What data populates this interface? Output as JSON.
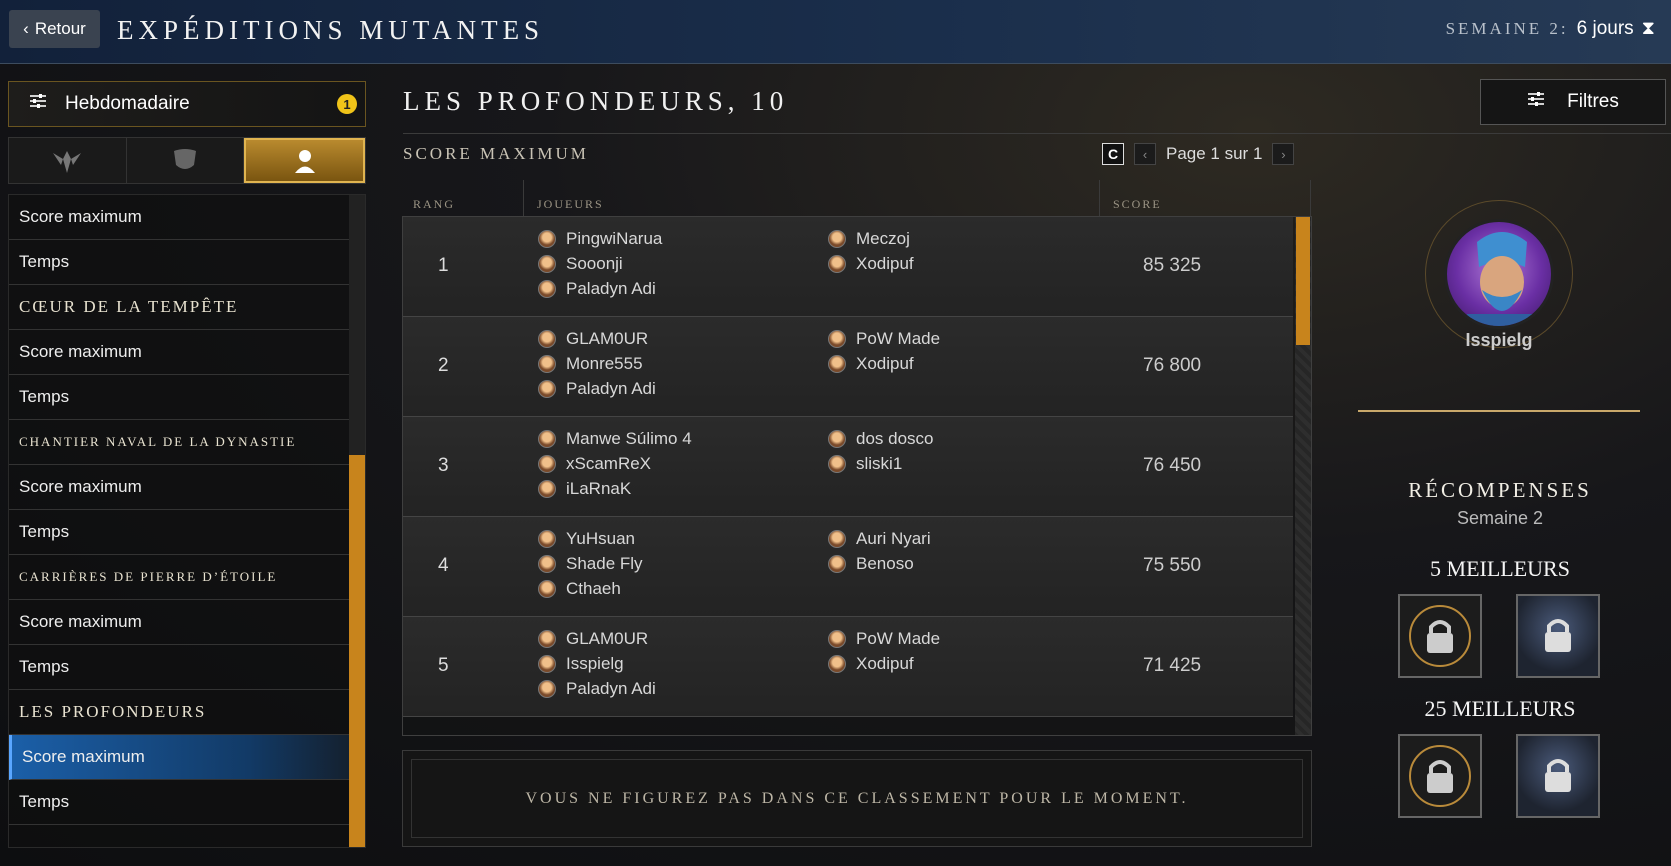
{
  "header": {
    "back_label": "Retour",
    "title": "EXPÉDITIONS MUTANTES",
    "week_label": "SEMAINE 2:",
    "time_left": "6 jours"
  },
  "sidebar": {
    "period_label": "Hebdomadaire",
    "period_badge": "1",
    "tabs": [
      "wings-emblem-icon",
      "shield-icon",
      "player-icon"
    ],
    "items": [
      {
        "type": "item",
        "label": "Score maximum"
      },
      {
        "type": "item",
        "label": "Temps"
      },
      {
        "type": "header",
        "label": "CŒUR DE LA TEMPÊTE"
      },
      {
        "type": "item",
        "label": "Score maximum"
      },
      {
        "type": "item",
        "label": "Temps"
      },
      {
        "type": "header",
        "label": "CHANTIER NAVAL DE LA DYNASTIE"
      },
      {
        "type": "item",
        "label": "Score maximum"
      },
      {
        "type": "item",
        "label": "Temps"
      },
      {
        "type": "header",
        "label": "CARRIÈRES DE PIERRE D’ÉTOILE"
      },
      {
        "type": "item",
        "label": "Score maximum"
      },
      {
        "type": "item",
        "label": "Temps"
      },
      {
        "type": "header",
        "label": "LES PROFONDEURS"
      },
      {
        "type": "item",
        "label": "Score maximum",
        "selected": true
      },
      {
        "type": "item",
        "label": "Temps"
      }
    ]
  },
  "main": {
    "title": "LES PROFONDEURS, 10",
    "subtitle": "SCORE MAXIMUM",
    "filters_label": "Filtres",
    "refresh_label": "C",
    "page_label": "Page 1 sur 1",
    "columns": {
      "rank": "RANG",
      "players": "JOUEURS",
      "score": "SCORE"
    },
    "rows": [
      {
        "rank": "1",
        "score": "85 325",
        "players": [
          "PingwiNarua",
          "Sooonji",
          "Paladyn Adi",
          "Meczoj",
          "Xodipuf"
        ]
      },
      {
        "rank": "2",
        "score": "76 800",
        "players": [
          "GLAM0UR",
          "Monre555",
          "Paladyn Adi",
          "PoW Made",
          "Xodipuf"
        ]
      },
      {
        "rank": "3",
        "score": "76 450",
        "players": [
          "Manwe Súlimo 4",
          "xScamReX",
          "iLaRnaK",
          "dos dosco",
          "sliski1"
        ]
      },
      {
        "rank": "4",
        "score": "75 550",
        "players": [
          "YuHsuan",
          "Shade Fly",
          "Cthaeh",
          "Auri Nyari",
          "Benoso"
        ]
      },
      {
        "rank": "5",
        "score": "71 425",
        "players": [
          "GLAM0UR",
          "Isspielg",
          "Paladyn Adi",
          "PoW Made",
          "Xodipuf"
        ]
      }
    ],
    "notice": "VOUS NE FIGUREZ PAS DANS CE CLASSEMENT POUR LE MOMENT."
  },
  "profile": {
    "name": "Isspielg"
  },
  "rewards": {
    "title": "RÉCOMPENSES",
    "week": "Semaine 2",
    "tiers": [
      {
        "label": "5 MEILLEURS"
      },
      {
        "label": "25 MEILLEURS"
      }
    ]
  },
  "colors": {
    "accent": "#c8841c",
    "selected": "#1b5fa8",
    "badge": "#f0c419"
  }
}
